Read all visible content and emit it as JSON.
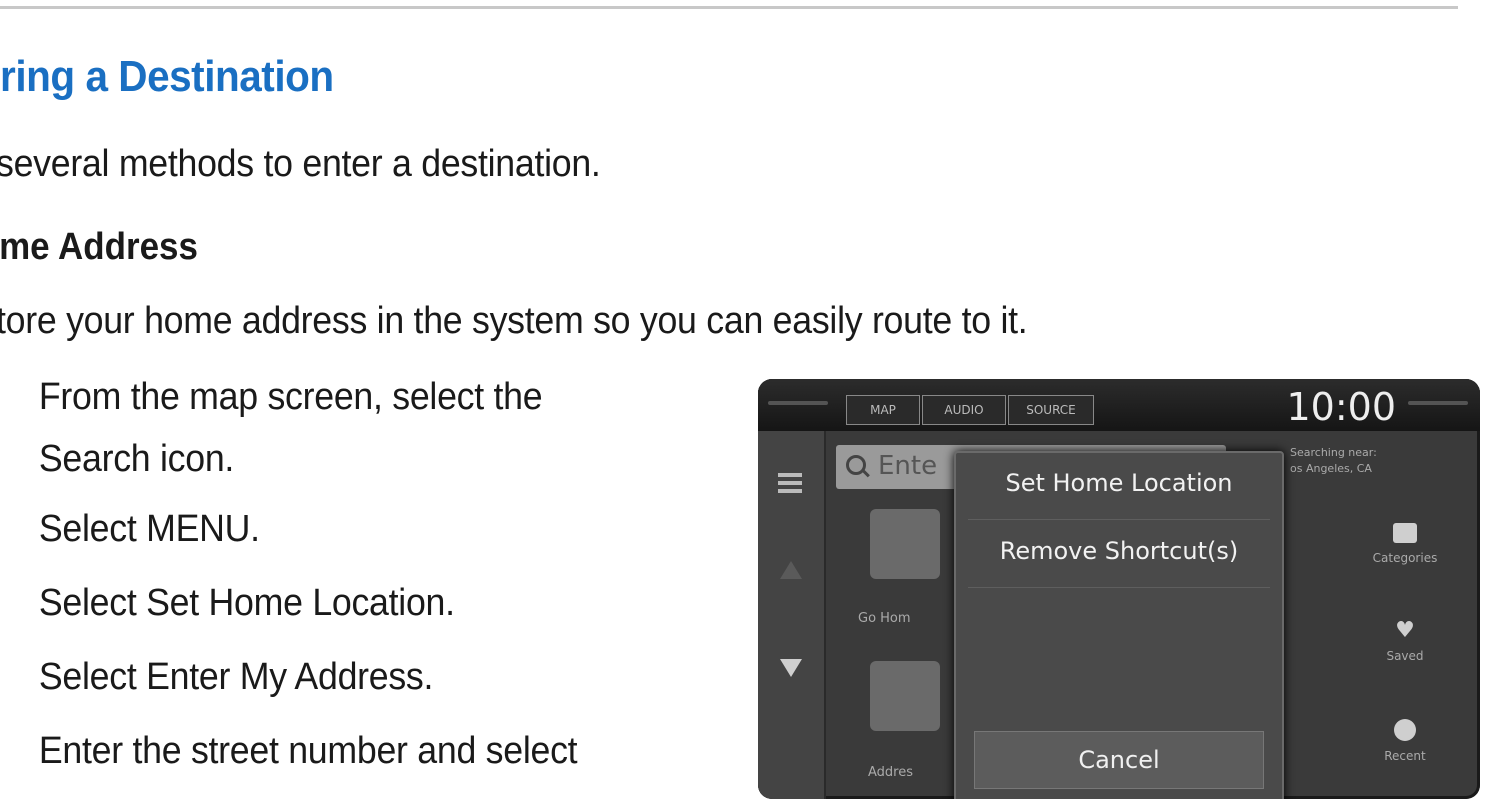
{
  "heading": "ering a Destination",
  "intro": "several methods to enter a destination.",
  "subheading": "lome Address",
  "subintro": "tore your home address in the system so you can easily route to it.",
  "steps": [
    {
      "num": ".",
      "lines": [
        "From the map screen, select the",
        "Search icon."
      ]
    },
    {
      "num": ".",
      "lines": [
        "Select MENU."
      ]
    },
    {
      "num": ".",
      "lines": [
        "Select Set Home Location."
      ]
    },
    {
      "num": ".",
      "lines": [
        "Select Enter My Address."
      ]
    },
    {
      "num": ".",
      "lines": [
        "Enter the street number and select"
      ]
    }
  ],
  "screen": {
    "tabs": [
      "MAP",
      "AUDIO",
      "SOURCE"
    ],
    "clock": "10:00",
    "search_placeholder": "Ente",
    "searching_near": [
      "Searching near:",
      "os Angeles, CA"
    ],
    "tiles": [
      "Go Hom",
      "Addres"
    ],
    "right_items": [
      "Categories",
      "Saved",
      "Recent"
    ],
    "popup_items": [
      "Set Home Location",
      "Remove Shortcut(s)"
    ],
    "cancel": "Cancel"
  },
  "colors": {
    "heading": "#1a6fc2",
    "screen_bg": "#3a3a3a"
  }
}
